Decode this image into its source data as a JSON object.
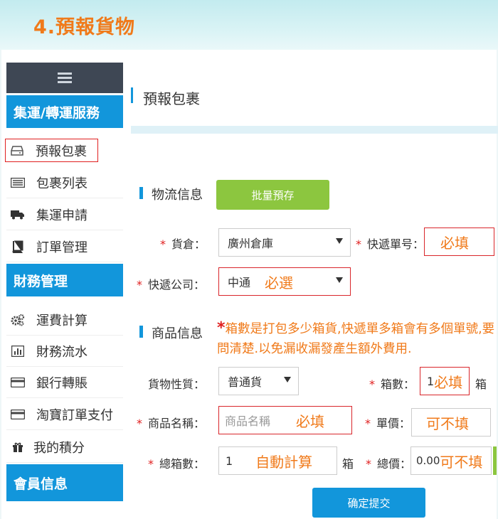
{
  "header": {
    "step_title": "4.預報貨物"
  },
  "sidebar": {
    "sections": [
      {
        "title": "集運/轉運服務",
        "items": [
          {
            "label": "預報包裹",
            "icon": "hard-drive-icon"
          },
          {
            "label": "包裹列表",
            "icon": "list-icon"
          },
          {
            "label": "集運申請",
            "icon": "truck-icon"
          },
          {
            "label": "訂單管理",
            "icon": "book-icon"
          }
        ]
      },
      {
        "title": "財務管理",
        "items": [
          {
            "label": "運費計算",
            "icon": "gears-icon"
          },
          {
            "label": "財務流水",
            "icon": "bar-chart-icon"
          },
          {
            "label": "銀行轉賬",
            "icon": "credit-card-icon"
          },
          {
            "label": "淘寶訂單支付",
            "icon": "credit-card-icon"
          },
          {
            "label": "我的積分",
            "icon": "gift-icon"
          }
        ]
      },
      {
        "title": "會員信息",
        "items": []
      }
    ]
  },
  "main": {
    "title": "預報包裹",
    "logistics": {
      "section_label": "物流信息",
      "batch_button": "批量預存",
      "warehouse_label": "貨倉：",
      "warehouse_value": "廣州倉庫",
      "tracking_label": "快遞單号：",
      "tracking_hint": "必填",
      "courier_label": "快遞公司：",
      "courier_value": "中通",
      "courier_hint": "必選"
    },
    "goods": {
      "section_label": "商品信息",
      "note_star": "*",
      "note": "箱數是打包多少箱貨,快遞單多箱會有多個單號,要問清楚.以免漏收漏發產生額外費用.",
      "nature_label": "貨物性質：",
      "nature_value": "普通貨",
      "boxes_label": "箱數：",
      "boxes_value": "1",
      "boxes_hint": "必填",
      "boxes_unit": "箱",
      "name_label": "商品名稱：",
      "name_placeholder": "商品名稱",
      "name_hint": "必填",
      "price_label": "單價：",
      "price_hint": "可不填",
      "total_boxes_label": "總箱數：",
      "total_boxes_value": "1",
      "total_boxes_hint": "自動計算",
      "total_boxes_unit": "箱",
      "total_price_label": "總價：",
      "total_price_value": "0.00",
      "total_price_hint": "可不填"
    },
    "submit_button": "确定提交"
  },
  "colors": {
    "accent_blue": "#1296db",
    "green": "#8cc63f",
    "orange": "#f07a1a",
    "required_red": "#e02020",
    "sidebar_dark": "#3e4754"
  }
}
